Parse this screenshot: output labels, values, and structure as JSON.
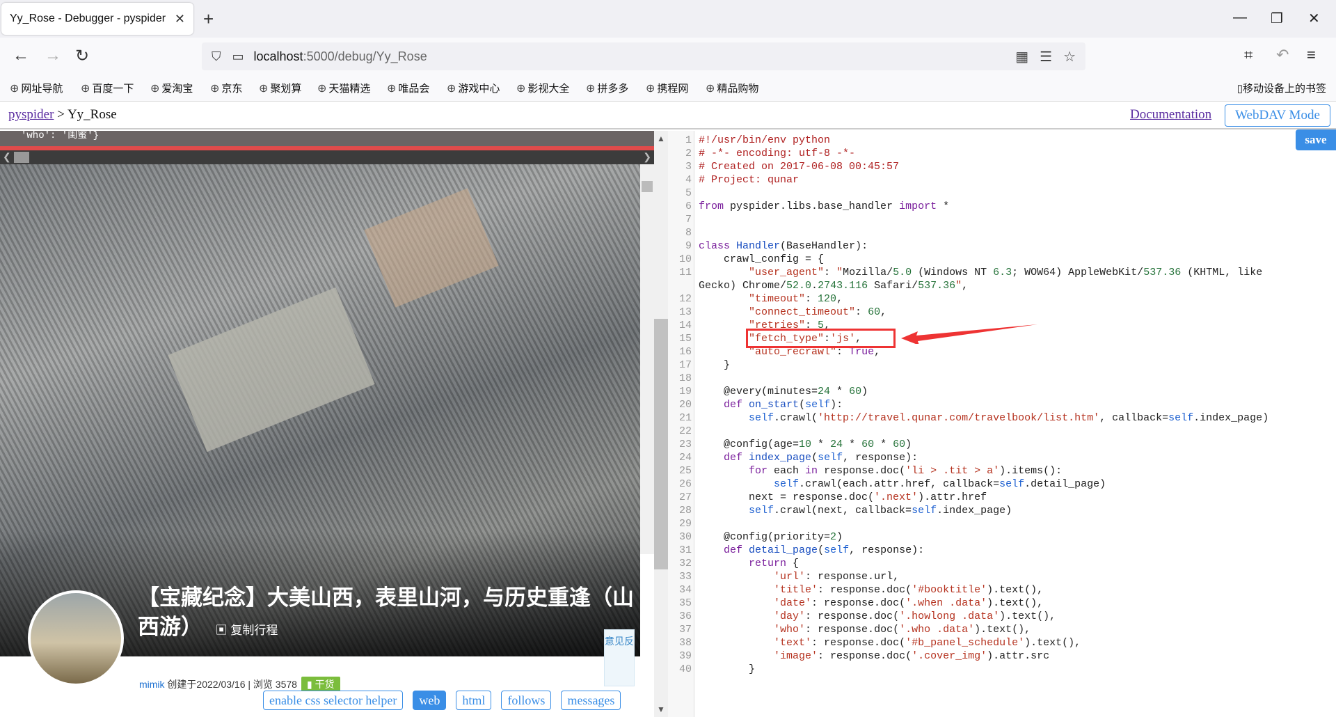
{
  "browser": {
    "tab_title": "Yy_Rose - Debugger - pyspider",
    "tab_close": "✕",
    "new_tab": "+",
    "url_host": "localhost",
    "url_path": ":5000/debug/Yy_Rose",
    "win_min": "—",
    "win_max": "❐",
    "win_close": "✕"
  },
  "bookmarks": [
    "网址导航",
    "百度一下",
    "爱淘宝",
    "京东",
    "聚划算",
    "天猫精选",
    "唯品会",
    "游戏中心",
    "影视大全",
    "拼多多",
    "携程网",
    "精品购物"
  ],
  "mobile_bookmarks": "移动设备上的书签",
  "header": {
    "crumb_link": "pyspider",
    "crumb_sep": " > ",
    "crumb_project": "Yy_Rose",
    "doc_link": "Documentation",
    "webdav": "WebDAV Mode"
  },
  "left": {
    "json_strip": "'who': '闺蜜'}",
    "article_title": "【宝藏纪念】大美山西，表里山河，与历史重逢（山西游）",
    "copy_trip": "复制行程",
    "meta_user": "mimik",
    "meta_created": " 创建于2022/03/16 | 浏览 3578",
    "meta_tag": "干货",
    "feedback": "意见反",
    "buttons": {
      "css_helper": "enable css selector helper",
      "web": "web",
      "html": "html",
      "follows": "follows",
      "messages": "messages"
    }
  },
  "editor": {
    "save": "save",
    "lines": [
      "#!/usr/bin/env python",
      "# -*- encoding: utf-8 -*-",
      "# Created on 2017-06-08 00:45:57",
      "# Project: qunar",
      "",
      "from pyspider.libs.base_handler import *",
      "",
      "",
      "class Handler(BaseHandler):",
      "    crawl_config = {",
      "        \"user_agent\": \"Mozilla/5.0 (Windows NT 6.3; WOW64) AppleWebKit/537.36 (KHTML, like",
      "Gecko) Chrome/52.0.2743.116 Safari/537.36\",",
      "        \"timeout\": 120,",
      "        \"connect_timeout\": 60,",
      "        \"retries\": 5,",
      "        \"fetch_type\":'js',",
      "        \"auto_recrawl\": True,",
      "    }",
      "",
      "    @every(minutes=24 * 60)",
      "    def on_start(self):",
      "        self.crawl('http://travel.qunar.com/travelbook/list.htm', callback=self.index_page)",
      "",
      "    @config(age=10 * 24 * 60 * 60)",
      "    def index_page(self, response):",
      "        for each in response.doc('li > .tit > a').items():",
      "            self.crawl(each.attr.href, callback=self.detail_page)",
      "        next = response.doc('.next').attr.href",
      "        self.crawl(next, callback=self.index_page)",
      "",
      "    @config(priority=2)",
      "    def detail_page(self, response):",
      "        return {",
      "            'url': response.url,",
      "            'title': response.doc('#booktitle').text(),",
      "            'date': response.doc('.when .data').text(),",
      "            'day': response.doc('.howlong .data').text(),",
      "            'who': response.doc('.who .data').text(),",
      "            'text': response.doc('#b_panel_schedule').text(),",
      "            'image': response.doc('.cover_img').attr.src",
      "        }"
    ],
    "line_numbers": [
      "1",
      "2",
      "3",
      "4",
      "5",
      "6",
      "7",
      "8",
      "9",
      "10",
      "11",
      "",
      "12",
      "13",
      "14",
      "15",
      "16",
      "17",
      "18",
      "19",
      "20",
      "21",
      "22",
      "23",
      "24",
      "25",
      "26",
      "27",
      "28",
      "29",
      "30",
      "31",
      "32",
      "33",
      "34",
      "35",
      "36",
      "37",
      "38",
      "39",
      "40"
    ]
  }
}
